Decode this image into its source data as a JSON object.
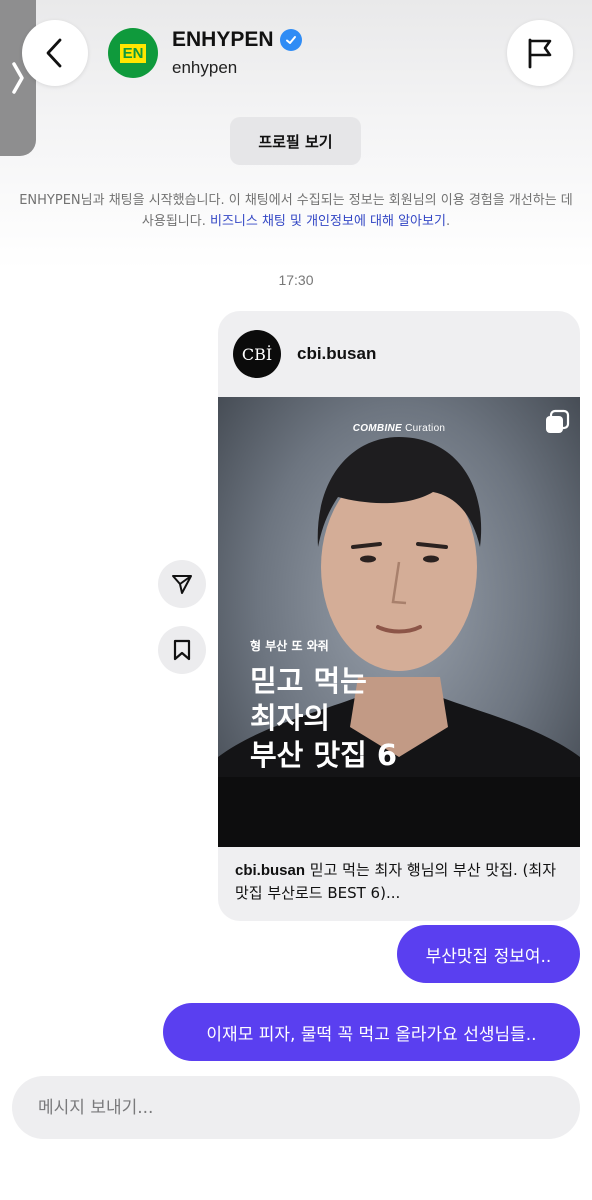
{
  "header": {
    "title": "ENHYPEN",
    "handle": "enhypen",
    "avatar_text": "EN",
    "verified": true
  },
  "profile_button": "프로필 보기",
  "notice": {
    "text": "ENHYPEN님과 채팅을 시작했습니다. 이 채팅에서 수집되는 정보는 회원님의 이용 경험을 개선하는 데 사용됩니다. ",
    "link": "비즈니스 채팅 및 개인정보에 대해 알아보기",
    "end": "."
  },
  "timestamp": "17:30",
  "shared_post": {
    "account": "cbi.busan",
    "avatar_text": "CBİ",
    "brand_bold": "COMBINE",
    "brand_rest": " Curation",
    "overlay_sub": "형 부산 또 와줘",
    "overlay_lines": [
      "믿고 먹는",
      "최자의",
      "부산 맛집 6"
    ],
    "caption_user": "cbi.busan",
    "caption_text": " 믿고 먹는 최자 행님의 부산 맛집. (최자맛집 부산로드 BEST 6)..."
  },
  "messages": [
    {
      "text": "부산맛집 정보여..",
      "sender": "me"
    },
    {
      "text": "이재모 피자, 물떡 꼭 먹고 올라가요 선생님들..",
      "sender": "me"
    }
  ],
  "composer": {
    "placeholder": "메시지 보내기..."
  },
  "icons": {
    "side_tab": "chevron-right-icon",
    "back": "back-arrow-icon",
    "report": "flag-icon",
    "share": "send-icon",
    "save": "bookmark-icon",
    "carousel": "multiple-images-icon",
    "verified": "verified-badge-icon"
  },
  "colors": {
    "bubble": "#5a3ff0",
    "link": "#3448c5",
    "verified": "#2f8cf5",
    "en_green": "#0f9a3c",
    "en_yellow": "#ffe600"
  }
}
